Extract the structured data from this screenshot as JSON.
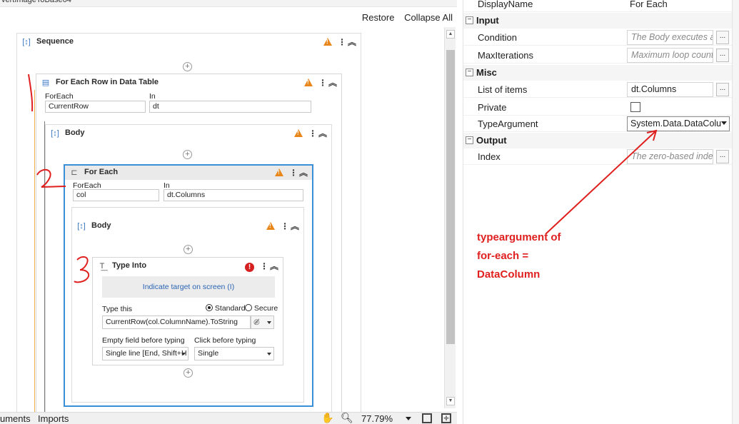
{
  "designer": {
    "top_fragment": "vertImageToBase64",
    "restore_label": "Restore",
    "collapse_all_label": "Collapse All",
    "sequence": {
      "title": "Sequence"
    },
    "for_each_row": {
      "title": "For Each Row in Data Table",
      "foreach_label": "ForEach",
      "foreach_value": "CurrentRow",
      "in_label": "In",
      "in_value": "dt",
      "body_title": "Body"
    },
    "for_each": {
      "title": "For Each",
      "foreach_label": "ForEach",
      "foreach_value": "col",
      "in_label": "In",
      "in_value": "dt.Columns",
      "body_title": "Body"
    },
    "type_into": {
      "title": "Type Into",
      "indicate_label": "Indicate target on screen (I)",
      "type_this_label": "Type this",
      "standard_label": "Standard",
      "secure_label": "Secure",
      "text_value": "CurrentRow(col.ColumnName).ToString",
      "empty_field_label": "Empty field before typing",
      "empty_field_value": "Single line [End, Shift+H",
      "click_before_label": "Click before typing",
      "click_before_value": "Single"
    },
    "annotations": [
      "1",
      "2",
      "3"
    ]
  },
  "statusbar": {
    "arguments_label": "uments",
    "imports_label": "Imports",
    "zoom": "77.79%"
  },
  "properties": {
    "display_name_label": "DisplayName",
    "display_name_value": "For Each",
    "categories": {
      "input": "Input",
      "misc": "Misc",
      "output": "Output"
    },
    "condition": {
      "label": "Condition",
      "placeholder": "The Body executes as"
    },
    "max_iterations": {
      "label": "MaxIterations",
      "placeholder": "Maximum loop count"
    },
    "list_of_items": {
      "label": "List of items",
      "value": "dt.Columns"
    },
    "private": {
      "label": "Private",
      "checked": false
    },
    "type_argument": {
      "label": "TypeArgument",
      "value": "System.Data.DataColu"
    },
    "index": {
      "label": "Index",
      "placeholder": "The zero-based index"
    },
    "dots_label": "..."
  },
  "note": {
    "line1": "typeargument of",
    "line2": "for-each =",
    "line3": "DataColumn"
  },
  "colors": {
    "accent": "#3b79c4",
    "warning": "#e8861a",
    "error": "#d42020",
    "annotation": "#e01f1f"
  }
}
